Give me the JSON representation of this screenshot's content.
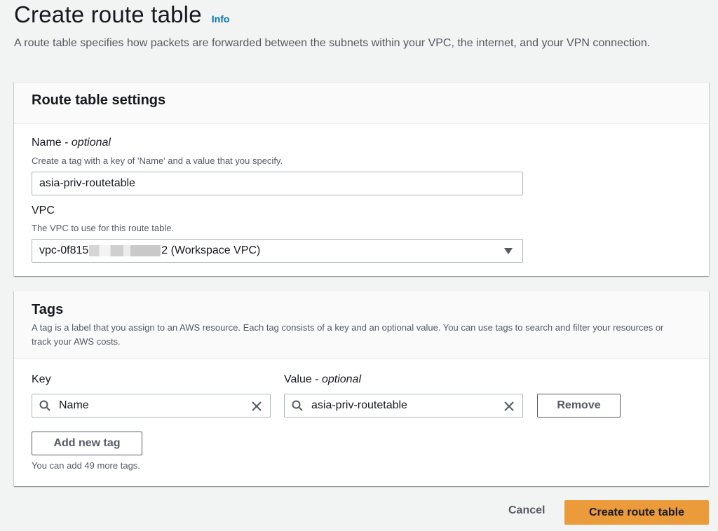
{
  "header": {
    "title": "Create route table",
    "info_label": "Info",
    "description": "A route table specifies how packets are forwarded between the subnets within your VPC, the internet, and your VPN connection."
  },
  "settings_panel": {
    "title": "Route table settings",
    "name_field": {
      "label": "Name - ",
      "label_optional": "optional",
      "help": "Create a tag with a key of 'Name' and a value that you specify.",
      "value": "asia-priv-routetable"
    },
    "vpc_field": {
      "label": "VPC",
      "help": "The VPC to use for this route table.",
      "value_prefix": "vpc-0f815",
      "value_suffix": "2 (Workspace VPC)",
      "redacted": true,
      "icon": "caret-down-icon"
    }
  },
  "tags_panel": {
    "title": "Tags",
    "description": "A tag is a label that you assign to an AWS resource. Each tag consists of a key and an optional value. You can use tags to search and filter your resources or track your AWS costs.",
    "key_header": "Key",
    "value_header": "Value - ",
    "value_header_optional": "optional",
    "tags": [
      {
        "key": "Name",
        "value": "asia-priv-routetable",
        "remove_label": "Remove"
      }
    ],
    "icons": {
      "search": "search-icon",
      "clear": "close-icon"
    },
    "add_button_label": "Add new tag",
    "remaining_text": "You can add 49 more tags."
  },
  "footer": {
    "cancel_label": "Cancel",
    "submit_label": "Create route table",
    "submit_color": "#ec9b3a"
  }
}
